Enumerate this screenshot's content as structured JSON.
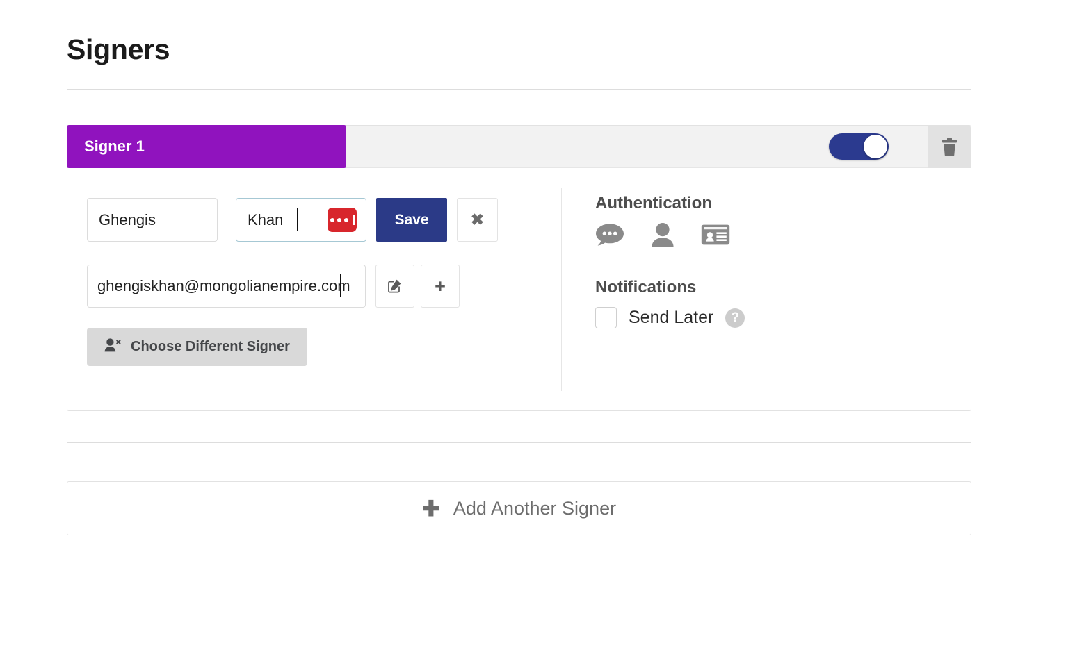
{
  "page": {
    "title": "Signers"
  },
  "colors": {
    "signer_badge_purple": "#9013be",
    "toggle_on_navy": "#2b3a8f",
    "save_button_navy": "#2b3a87",
    "lastpass_red": "#d8262c",
    "choose_signer_gray": "#d9d9d9",
    "trash_button_gray": "#e2e2e2",
    "focused_input_border": "#a6c8d4"
  },
  "signer": {
    "badge_label": "Signer 1",
    "enabled_toggle": {
      "name": "signer-enabled-toggle",
      "state": "on"
    },
    "delete_icon": "trash-icon",
    "first_name": {
      "value": "Ghengis",
      "placeholder": "First Name"
    },
    "last_name": {
      "value": "Khan",
      "placeholder": "Last Name",
      "focused": true,
      "autofill_icon": "lastpass-icon"
    },
    "save_label": "Save",
    "cancel_label": "✖",
    "email": {
      "value": "ghengiskhan@mongolianempire.com",
      "placeholder": "Email"
    },
    "email_edit_icon": "edit-pencil-square-icon",
    "add_email_label": "+",
    "choose_different_signer_label": "Choose Different Signer",
    "choose_different_signer_icon": "user-times-icon"
  },
  "authentication": {
    "title": "Authentication",
    "options": [
      {
        "icon": "sms-chat-bubble-icon",
        "name": "auth-sms"
      },
      {
        "icon": "person-identity-icon",
        "name": "auth-identity"
      },
      {
        "icon": "id-card-icon",
        "name": "auth-id-card"
      }
    ]
  },
  "notifications": {
    "title": "Notifications",
    "send_later": {
      "label": "Send Later",
      "checked": false,
      "help_icon": "question-mark-help-icon",
      "help_glyph": "?"
    }
  },
  "footer": {
    "add_another_signer_label": "Add Another Signer",
    "add_another_signer_icon": "plus-icon",
    "plus_glyph": "✚"
  }
}
